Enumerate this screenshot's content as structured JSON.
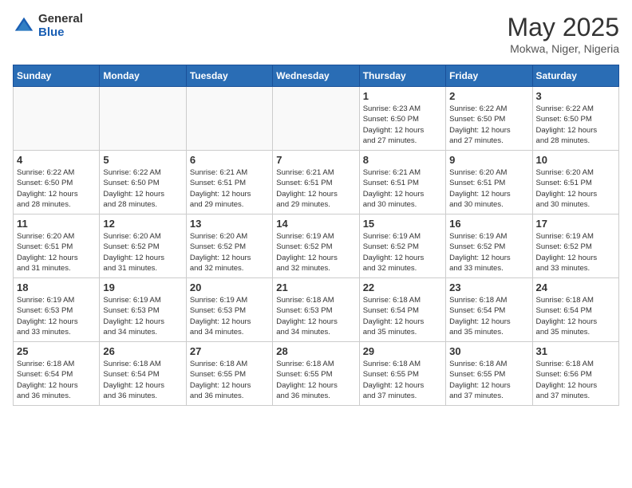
{
  "logo": {
    "general": "General",
    "blue": "Blue"
  },
  "title": "May 2025",
  "location": "Mokwa, Niger, Nigeria",
  "days_of_week": [
    "Sunday",
    "Monday",
    "Tuesday",
    "Wednesday",
    "Thursday",
    "Friday",
    "Saturday"
  ],
  "weeks": [
    [
      {
        "num": "",
        "info": ""
      },
      {
        "num": "",
        "info": ""
      },
      {
        "num": "",
        "info": ""
      },
      {
        "num": "",
        "info": ""
      },
      {
        "num": "1",
        "info": "Sunrise: 6:23 AM\nSunset: 6:50 PM\nDaylight: 12 hours\nand 27 minutes."
      },
      {
        "num": "2",
        "info": "Sunrise: 6:22 AM\nSunset: 6:50 PM\nDaylight: 12 hours\nand 27 minutes."
      },
      {
        "num": "3",
        "info": "Sunrise: 6:22 AM\nSunset: 6:50 PM\nDaylight: 12 hours\nand 28 minutes."
      }
    ],
    [
      {
        "num": "4",
        "info": "Sunrise: 6:22 AM\nSunset: 6:50 PM\nDaylight: 12 hours\nand 28 minutes."
      },
      {
        "num": "5",
        "info": "Sunrise: 6:22 AM\nSunset: 6:50 PM\nDaylight: 12 hours\nand 28 minutes."
      },
      {
        "num": "6",
        "info": "Sunrise: 6:21 AM\nSunset: 6:51 PM\nDaylight: 12 hours\nand 29 minutes."
      },
      {
        "num": "7",
        "info": "Sunrise: 6:21 AM\nSunset: 6:51 PM\nDaylight: 12 hours\nand 29 minutes."
      },
      {
        "num": "8",
        "info": "Sunrise: 6:21 AM\nSunset: 6:51 PM\nDaylight: 12 hours\nand 30 minutes."
      },
      {
        "num": "9",
        "info": "Sunrise: 6:20 AM\nSunset: 6:51 PM\nDaylight: 12 hours\nand 30 minutes."
      },
      {
        "num": "10",
        "info": "Sunrise: 6:20 AM\nSunset: 6:51 PM\nDaylight: 12 hours\nand 30 minutes."
      }
    ],
    [
      {
        "num": "11",
        "info": "Sunrise: 6:20 AM\nSunset: 6:51 PM\nDaylight: 12 hours\nand 31 minutes."
      },
      {
        "num": "12",
        "info": "Sunrise: 6:20 AM\nSunset: 6:52 PM\nDaylight: 12 hours\nand 31 minutes."
      },
      {
        "num": "13",
        "info": "Sunrise: 6:20 AM\nSunset: 6:52 PM\nDaylight: 12 hours\nand 32 minutes."
      },
      {
        "num": "14",
        "info": "Sunrise: 6:19 AM\nSunset: 6:52 PM\nDaylight: 12 hours\nand 32 minutes."
      },
      {
        "num": "15",
        "info": "Sunrise: 6:19 AM\nSunset: 6:52 PM\nDaylight: 12 hours\nand 32 minutes."
      },
      {
        "num": "16",
        "info": "Sunrise: 6:19 AM\nSunset: 6:52 PM\nDaylight: 12 hours\nand 33 minutes."
      },
      {
        "num": "17",
        "info": "Sunrise: 6:19 AM\nSunset: 6:52 PM\nDaylight: 12 hours\nand 33 minutes."
      }
    ],
    [
      {
        "num": "18",
        "info": "Sunrise: 6:19 AM\nSunset: 6:53 PM\nDaylight: 12 hours\nand 33 minutes."
      },
      {
        "num": "19",
        "info": "Sunrise: 6:19 AM\nSunset: 6:53 PM\nDaylight: 12 hours\nand 34 minutes."
      },
      {
        "num": "20",
        "info": "Sunrise: 6:19 AM\nSunset: 6:53 PM\nDaylight: 12 hours\nand 34 minutes."
      },
      {
        "num": "21",
        "info": "Sunrise: 6:18 AM\nSunset: 6:53 PM\nDaylight: 12 hours\nand 34 minutes."
      },
      {
        "num": "22",
        "info": "Sunrise: 6:18 AM\nSunset: 6:54 PM\nDaylight: 12 hours\nand 35 minutes."
      },
      {
        "num": "23",
        "info": "Sunrise: 6:18 AM\nSunset: 6:54 PM\nDaylight: 12 hours\nand 35 minutes."
      },
      {
        "num": "24",
        "info": "Sunrise: 6:18 AM\nSunset: 6:54 PM\nDaylight: 12 hours\nand 35 minutes."
      }
    ],
    [
      {
        "num": "25",
        "info": "Sunrise: 6:18 AM\nSunset: 6:54 PM\nDaylight: 12 hours\nand 36 minutes."
      },
      {
        "num": "26",
        "info": "Sunrise: 6:18 AM\nSunset: 6:54 PM\nDaylight: 12 hours\nand 36 minutes."
      },
      {
        "num": "27",
        "info": "Sunrise: 6:18 AM\nSunset: 6:55 PM\nDaylight: 12 hours\nand 36 minutes."
      },
      {
        "num": "28",
        "info": "Sunrise: 6:18 AM\nSunset: 6:55 PM\nDaylight: 12 hours\nand 36 minutes."
      },
      {
        "num": "29",
        "info": "Sunrise: 6:18 AM\nSunset: 6:55 PM\nDaylight: 12 hours\nand 37 minutes."
      },
      {
        "num": "30",
        "info": "Sunrise: 6:18 AM\nSunset: 6:55 PM\nDaylight: 12 hours\nand 37 minutes."
      },
      {
        "num": "31",
        "info": "Sunrise: 6:18 AM\nSunset: 6:56 PM\nDaylight: 12 hours\nand 37 minutes."
      }
    ]
  ]
}
